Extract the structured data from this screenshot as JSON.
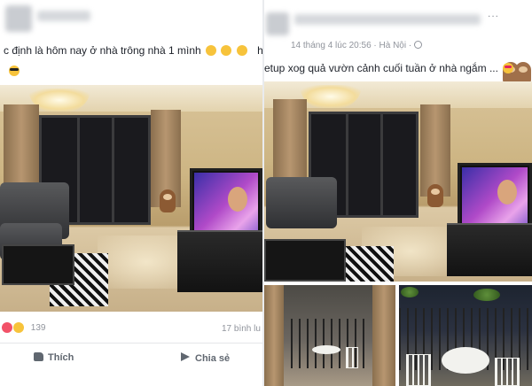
{
  "post_left": {
    "text_line1": "c định là hôm nay ở nhà trông nhà 1 mình",
    "text_line1_tail": "hay",
    "reaction_count": "139",
    "comments": "17 bình lu",
    "like_label": "Thích",
    "share_label": "Chia sẻ"
  },
  "post_right": {
    "timestamp": "14 tháng 4 lúc 20:56 · Hà Nội ·",
    "text": "etup xog quả vườn cảnh cuối tuần ở nhà ngắm ...",
    "more": "..."
  },
  "icons": {
    "like": "thumbs-up-icon",
    "share": "share-arrow-icon",
    "privacy": "globe-icon",
    "love": "love-reaction-icon",
    "haha": "haha-reaction-icon"
  },
  "colors": {
    "page_bg": "#e9ebee",
    "text": "#1d2129",
    "muted": "#90949c",
    "action": "#606770"
  }
}
